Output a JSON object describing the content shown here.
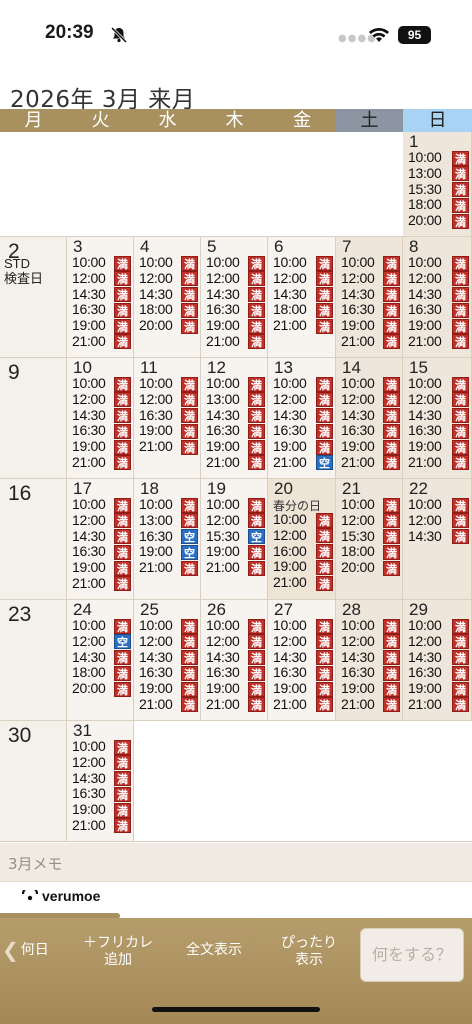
{
  "status": {
    "time": "20:39",
    "battery": "95"
  },
  "header": {
    "title": "2026年 3月 来月"
  },
  "weekdays": [
    "月",
    "火",
    "水",
    "木",
    "金",
    "土",
    "日"
  ],
  "colors": {
    "accent": "#a8905f",
    "full_badge": "#c2302a",
    "open_badge": "#2a6fc4",
    "saturday": "#8c96a2",
    "sunday": "#a9d3f4"
  },
  "legend": {
    "full": "満",
    "open": "空"
  },
  "weeks": [
    [
      null,
      null,
      null,
      null,
      null,
      null,
      {
        "day": "1",
        "slots": [
          [
            "10:00",
            "満"
          ],
          [
            "13:00",
            "満"
          ],
          [
            "15:30",
            "満"
          ],
          [
            "18:00",
            "満"
          ],
          [
            "20:00",
            "満"
          ]
        ]
      }
    ],
    [
      {
        "day": "2",
        "note": "STD\n検査日",
        "slots": []
      },
      {
        "day": "3",
        "slots": [
          [
            "10:00",
            "満"
          ],
          [
            "12:00",
            "満"
          ],
          [
            "14:30",
            "満"
          ],
          [
            "16:30",
            "満"
          ],
          [
            "19:00",
            "満"
          ],
          [
            "21:00",
            "満"
          ]
        ]
      },
      {
        "day": "4",
        "slots": [
          [
            "10:00",
            "満"
          ],
          [
            "12:00",
            "満"
          ],
          [
            "14:30",
            "満"
          ],
          [
            "18:00",
            "満"
          ],
          [
            "20:00",
            "満"
          ]
        ]
      },
      {
        "day": "5",
        "slots": [
          [
            "10:00",
            "満"
          ],
          [
            "12:00",
            "満"
          ],
          [
            "14:30",
            "満"
          ],
          [
            "16:30",
            "満"
          ],
          [
            "19:00",
            "満"
          ],
          [
            "21:00",
            "満"
          ]
        ]
      },
      {
        "day": "6",
        "slots": [
          [
            "10:00",
            "満"
          ],
          [
            "12:00",
            "満"
          ],
          [
            "14:30",
            "満"
          ],
          [
            "18:00",
            "満"
          ],
          [
            "21:00",
            "満"
          ]
        ]
      },
      {
        "day": "7",
        "slots": [
          [
            "10:00",
            "満"
          ],
          [
            "12:00",
            "満"
          ],
          [
            "14:30",
            "満"
          ],
          [
            "16:30",
            "満"
          ],
          [
            "19:00",
            "満"
          ],
          [
            "21:00",
            "満"
          ]
        ]
      },
      {
        "day": "8",
        "slots": [
          [
            "10:00",
            "満"
          ],
          [
            "12:00",
            "満"
          ],
          [
            "14:30",
            "満"
          ],
          [
            "16:30",
            "満"
          ],
          [
            "19:00",
            "満"
          ],
          [
            "21:00",
            "満"
          ]
        ]
      }
    ],
    [
      {
        "day": "9",
        "slots": []
      },
      {
        "day": "10",
        "slots": [
          [
            "10:00",
            "満"
          ],
          [
            "12:00",
            "満"
          ],
          [
            "14:30",
            "満"
          ],
          [
            "16:30",
            "満"
          ],
          [
            "19:00",
            "満"
          ],
          [
            "21:00",
            "満"
          ]
        ]
      },
      {
        "day": "11",
        "slots": [
          [
            "10:00",
            "満"
          ],
          [
            "12:00",
            "満"
          ],
          [
            "16:30",
            "満"
          ],
          [
            "19:00",
            "満"
          ],
          [
            "21:00",
            "満"
          ]
        ]
      },
      {
        "day": "12",
        "slots": [
          [
            "10:00",
            "満"
          ],
          [
            "13:00",
            "満"
          ],
          [
            "14:30",
            "満"
          ],
          [
            "16:30",
            "満"
          ],
          [
            "19:00",
            "満"
          ],
          [
            "21:00",
            "満"
          ]
        ]
      },
      {
        "day": "13",
        "slots": [
          [
            "10:00",
            "満"
          ],
          [
            "12:00",
            "満"
          ],
          [
            "14:30",
            "満"
          ],
          [
            "16:30",
            "満"
          ],
          [
            "19:00",
            "満"
          ],
          [
            "21:00",
            "空"
          ]
        ]
      },
      {
        "day": "14",
        "slots": [
          [
            "10:00",
            "満"
          ],
          [
            "12:00",
            "満"
          ],
          [
            "14:30",
            "満"
          ],
          [
            "16:30",
            "満"
          ],
          [
            "19:00",
            "満"
          ],
          [
            "21:00",
            "満"
          ]
        ]
      },
      {
        "day": "15",
        "slots": [
          [
            "10:00",
            "満"
          ],
          [
            "12:00",
            "満"
          ],
          [
            "14:30",
            "満"
          ],
          [
            "16:30",
            "満"
          ],
          [
            "19:00",
            "満"
          ],
          [
            "21:00",
            "満"
          ]
        ]
      }
    ],
    [
      {
        "day": "16",
        "slots": []
      },
      {
        "day": "17",
        "slots": [
          [
            "10:00",
            "満"
          ],
          [
            "12:00",
            "満"
          ],
          [
            "14:30",
            "満"
          ],
          [
            "16:30",
            "満"
          ],
          [
            "19:00",
            "満"
          ],
          [
            "21:00",
            "満"
          ]
        ]
      },
      {
        "day": "18",
        "slots": [
          [
            "10:00",
            "満"
          ],
          [
            "13:00",
            "満"
          ],
          [
            "16:30",
            "空"
          ],
          [
            "19:00",
            "空"
          ],
          [
            "21:00",
            "満"
          ]
        ]
      },
      {
        "day": "19",
        "slots": [
          [
            "10:00",
            "満"
          ],
          [
            "12:00",
            "満"
          ],
          [
            "15:30",
            "空"
          ],
          [
            "19:00",
            "満"
          ],
          [
            "21:00",
            "満"
          ]
        ]
      },
      {
        "day": "20",
        "holiday": "春分の日",
        "slots": [
          [
            "10:00",
            "満"
          ],
          [
            "12:00",
            "満"
          ],
          [
            "16:00",
            "満"
          ],
          [
            "19:00",
            "満"
          ],
          [
            "21:00",
            "満"
          ]
        ]
      },
      {
        "day": "21",
        "slots": [
          [
            "10:00",
            "満"
          ],
          [
            "12:00",
            "満"
          ],
          [
            "15:30",
            "満"
          ],
          [
            "18:00",
            "満"
          ],
          [
            "20:00",
            "満"
          ]
        ]
      },
      {
        "day": "22",
        "slots": [
          [
            "10:00",
            "満"
          ],
          [
            "12:00",
            "満"
          ],
          [
            "14:30",
            "満"
          ]
        ]
      }
    ],
    [
      {
        "day": "23",
        "slots": []
      },
      {
        "day": "24",
        "slots": [
          [
            "10:00",
            "満"
          ],
          [
            "12:00",
            "空"
          ],
          [
            "14:30",
            "満"
          ],
          [
            "18:00",
            "満"
          ],
          [
            "20:00",
            "満"
          ]
        ]
      },
      {
        "day": "25",
        "slots": [
          [
            "10:00",
            "満"
          ],
          [
            "12:00",
            "満"
          ],
          [
            "14:30",
            "満"
          ],
          [
            "16:30",
            "満"
          ],
          [
            "19:00",
            "満"
          ],
          [
            "21:00",
            "満"
          ]
        ]
      },
      {
        "day": "26",
        "slots": [
          [
            "10:00",
            "満"
          ],
          [
            "12:00",
            "満"
          ],
          [
            "14:30",
            "満"
          ],
          [
            "16:30",
            "満"
          ],
          [
            "19:00",
            "満"
          ],
          [
            "21:00",
            "満"
          ]
        ]
      },
      {
        "day": "27",
        "slots": [
          [
            "10:00",
            "満"
          ],
          [
            "12:00",
            "満"
          ],
          [
            "14:30",
            "満"
          ],
          [
            "16:30",
            "満"
          ],
          [
            "19:00",
            "満"
          ],
          [
            "21:00",
            "満"
          ]
        ]
      },
      {
        "day": "28",
        "slots": [
          [
            "10:00",
            "満"
          ],
          [
            "12:00",
            "満"
          ],
          [
            "14:30",
            "満"
          ],
          [
            "16:30",
            "満"
          ],
          [
            "19:00",
            "満"
          ],
          [
            "21:00",
            "満"
          ]
        ]
      },
      {
        "day": "29",
        "slots": [
          [
            "10:00",
            "満"
          ],
          [
            "12:00",
            "満"
          ],
          [
            "14:30",
            "満"
          ],
          [
            "16:30",
            "満"
          ],
          [
            "19:00",
            "満"
          ],
          [
            "21:00",
            "満"
          ]
        ]
      }
    ],
    [
      {
        "day": "30",
        "slots": []
      },
      {
        "day": "31",
        "slots": [
          [
            "10:00",
            "満"
          ],
          [
            "12:00",
            "満"
          ],
          [
            "14:30",
            "満"
          ],
          [
            "16:30",
            "満"
          ],
          [
            "19:00",
            "満"
          ],
          [
            "21:00",
            "満"
          ]
        ]
      },
      null,
      null,
      null,
      null,
      null
    ]
  ],
  "memo": {
    "label": "3月メモ"
  },
  "brand": {
    "logo_text": "verumoe"
  },
  "toolbar": {
    "back": "何日",
    "furigana": "＋フリカレ\n追加",
    "full_text": "全文表示",
    "fit": "ぴったり\n表示",
    "action": "何をする？"
  }
}
